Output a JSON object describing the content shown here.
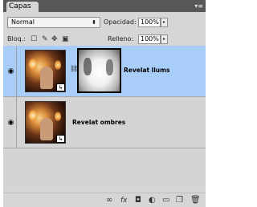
{
  "panel": {
    "tab_label": "Capas",
    "menu_icon": "panel-menu-icon"
  },
  "blend": {
    "mode": "Normal"
  },
  "opacity": {
    "label": "Opacidad:",
    "value": "100%"
  },
  "lock": {
    "label": "Bloq.:",
    "icons": [
      "lock-transparent-icon",
      "lock-brush-icon",
      "lock-move-icon",
      "lock-all-icon"
    ]
  },
  "fill": {
    "label": "Relleno:",
    "value": "100%"
  },
  "layers": [
    {
      "name": "Revelat llums",
      "selected": true,
      "has_mask": true
    },
    {
      "name": "Revelat ombres",
      "selected": false,
      "has_mask": false
    }
  ],
  "footer_icons": [
    "link-icon",
    "fx-icon",
    "mask-icon",
    "adjustment-icon",
    "folder-icon",
    "new-layer-icon",
    "trash-icon"
  ]
}
